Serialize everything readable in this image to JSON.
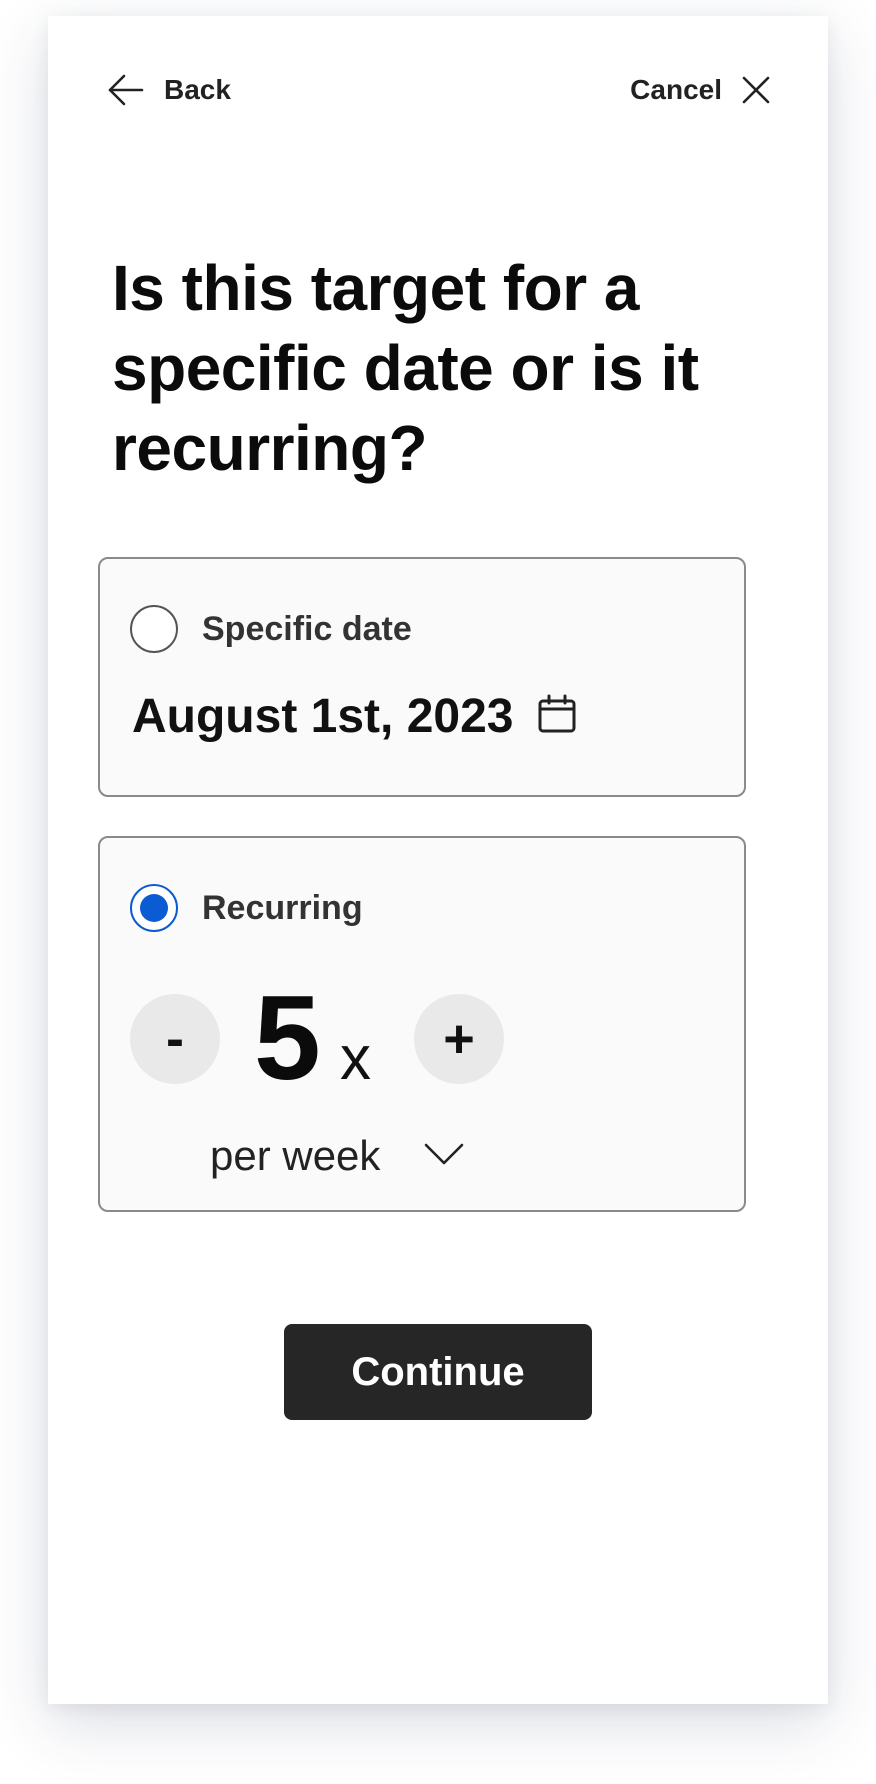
{
  "header": {
    "back_label": "Back",
    "back_icon": "arrow-left-icon",
    "cancel_label": "Cancel",
    "cancel_icon": "close-icon"
  },
  "question": "Is this target for a specific date or is it recurring?",
  "options": {
    "specific_date": {
      "label": "Specific date",
      "selected": false,
      "date_value": "August 1st, 2023",
      "icon": "calendar-icon"
    },
    "recurring": {
      "label": "Recurring",
      "selected": true,
      "decrement_label": "-",
      "count": "5",
      "count_suffix": "x",
      "increment_label": "+",
      "period_selected": "per week",
      "period_icon": "chevron-down-icon"
    }
  },
  "continue_label": "Continue",
  "colors": {
    "accent": "#0b5bd3",
    "button_bg": "#262626",
    "stepper_bg": "#e9e9e9",
    "option_border": "#8a8a8a"
  }
}
